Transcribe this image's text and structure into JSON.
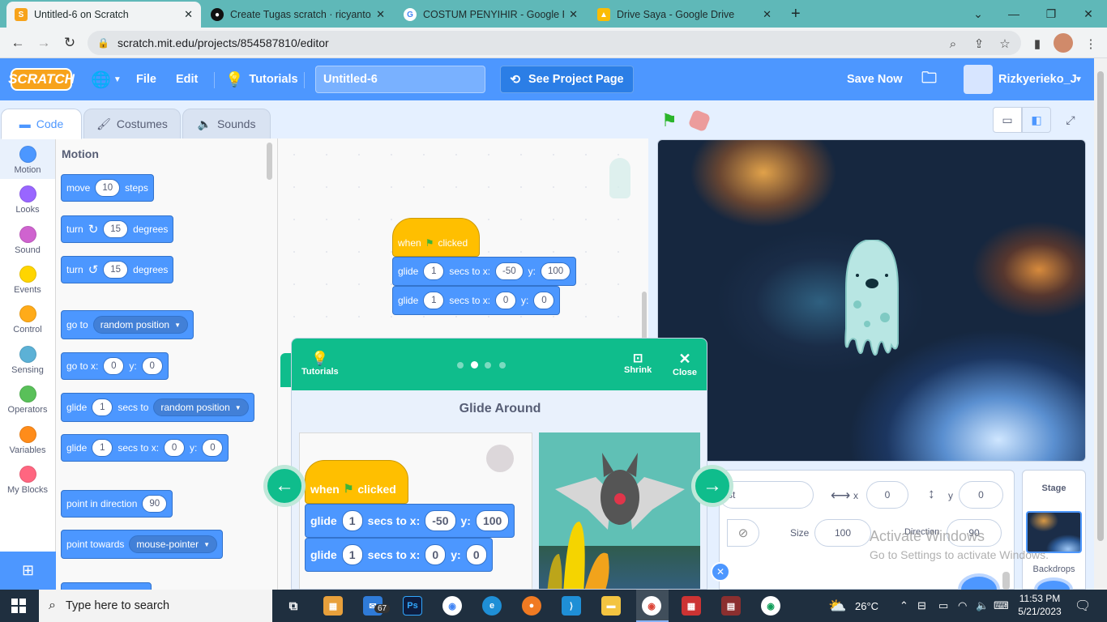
{
  "browser": {
    "tabs": [
      {
        "title": "Untitled-6 on Scratch",
        "icon": "scratch-cat-icon"
      },
      {
        "title": "Create Tugas scratch · ricyanto/R",
        "icon": "github-icon"
      },
      {
        "title": "COSTUM PENYIHIR - Google Pen",
        "icon": "google-icon"
      },
      {
        "title": "Drive Saya - Google Drive",
        "icon": "drive-icon"
      }
    ],
    "url": "scratch.mit.edu/projects/854587810/editor"
  },
  "menubar": {
    "logo": "SCRATCH",
    "file": "File",
    "edit": "Edit",
    "tutorials": "Tutorials",
    "project_title": "Untitled-6",
    "see_project_page": "See Project Page",
    "save_now": "Save Now",
    "username": "Rizkyerieko_J"
  },
  "editor_tabs": {
    "code": "Code",
    "costumes": "Costumes",
    "sounds": "Sounds"
  },
  "categories": [
    {
      "label": "Motion",
      "color": "#4c97ff"
    },
    {
      "label": "Looks",
      "color": "#9966ff"
    },
    {
      "label": "Sound",
      "color": "#cf63cf"
    },
    {
      "label": "Events",
      "color": "#ffd500"
    },
    {
      "label": "Control",
      "color": "#ffab19"
    },
    {
      "label": "Sensing",
      "color": "#5cb1d6"
    },
    {
      "label": "Operators",
      "color": "#59c059"
    },
    {
      "label": "Variables",
      "color": "#ff8c1a"
    },
    {
      "label": "My Blocks",
      "color": "#ff6680"
    }
  ],
  "palette": {
    "heading": "Motion",
    "move": {
      "a": "move",
      "n": "10",
      "b": "steps"
    },
    "turn_right": {
      "a": "turn",
      "n": "15",
      "b": "degrees"
    },
    "turn_left": {
      "a": "turn",
      "n": "15",
      "b": "degrees"
    },
    "go_to": {
      "a": "go to",
      "opt": "random position"
    },
    "go_to_xy": {
      "a": "go to x:",
      "x": "0",
      "b": "y:",
      "y": "0"
    },
    "glide_to": {
      "a": "glide",
      "n": "1",
      "b": "secs to",
      "opt": "random position"
    },
    "glide_xy": {
      "a": "glide",
      "n": "1",
      "b": "secs to x:",
      "x": "0",
      "c": "y:",
      "y": "0"
    },
    "point_dir": {
      "a": "point in direction",
      "n": "90"
    },
    "point_towards": {
      "a": "point towards",
      "opt": "mouse-pointer"
    }
  },
  "script": {
    "hat": {
      "a": "when",
      "b": "clicked"
    },
    "glide1": {
      "a": "glide",
      "n": "1",
      "b": "secs to x:",
      "x": "-50",
      "c": "y:",
      "y": "100"
    },
    "glide2": {
      "a": "glide",
      "n": "1",
      "b": "secs to x:",
      "x": "0",
      "c": "y:",
      "y": "0"
    }
  },
  "tutorial": {
    "tutorials_label": "Tutorials",
    "shrink": "Shrink",
    "close": "Close",
    "title": "Glide Around",
    "page": 2,
    "pages": 4
  },
  "sprite_info": {
    "sprite_name_partial": "st",
    "x_label": "x",
    "x": "0",
    "y_label": "y",
    "y": "0",
    "size_label": "Size",
    "size": "100",
    "direction_label": "Direction",
    "direction": "90"
  },
  "stage_panel": {
    "title": "Stage",
    "backdrops": "Backdrops"
  },
  "watermark": {
    "line1": "Activate Windows",
    "line2": "Go to Settings to activate Windows."
  },
  "taskbar": {
    "search": "Type here to search",
    "mail_badge": "67",
    "temperature": "26°C",
    "time": "11:53 PM",
    "date": "5/21/2023"
  }
}
